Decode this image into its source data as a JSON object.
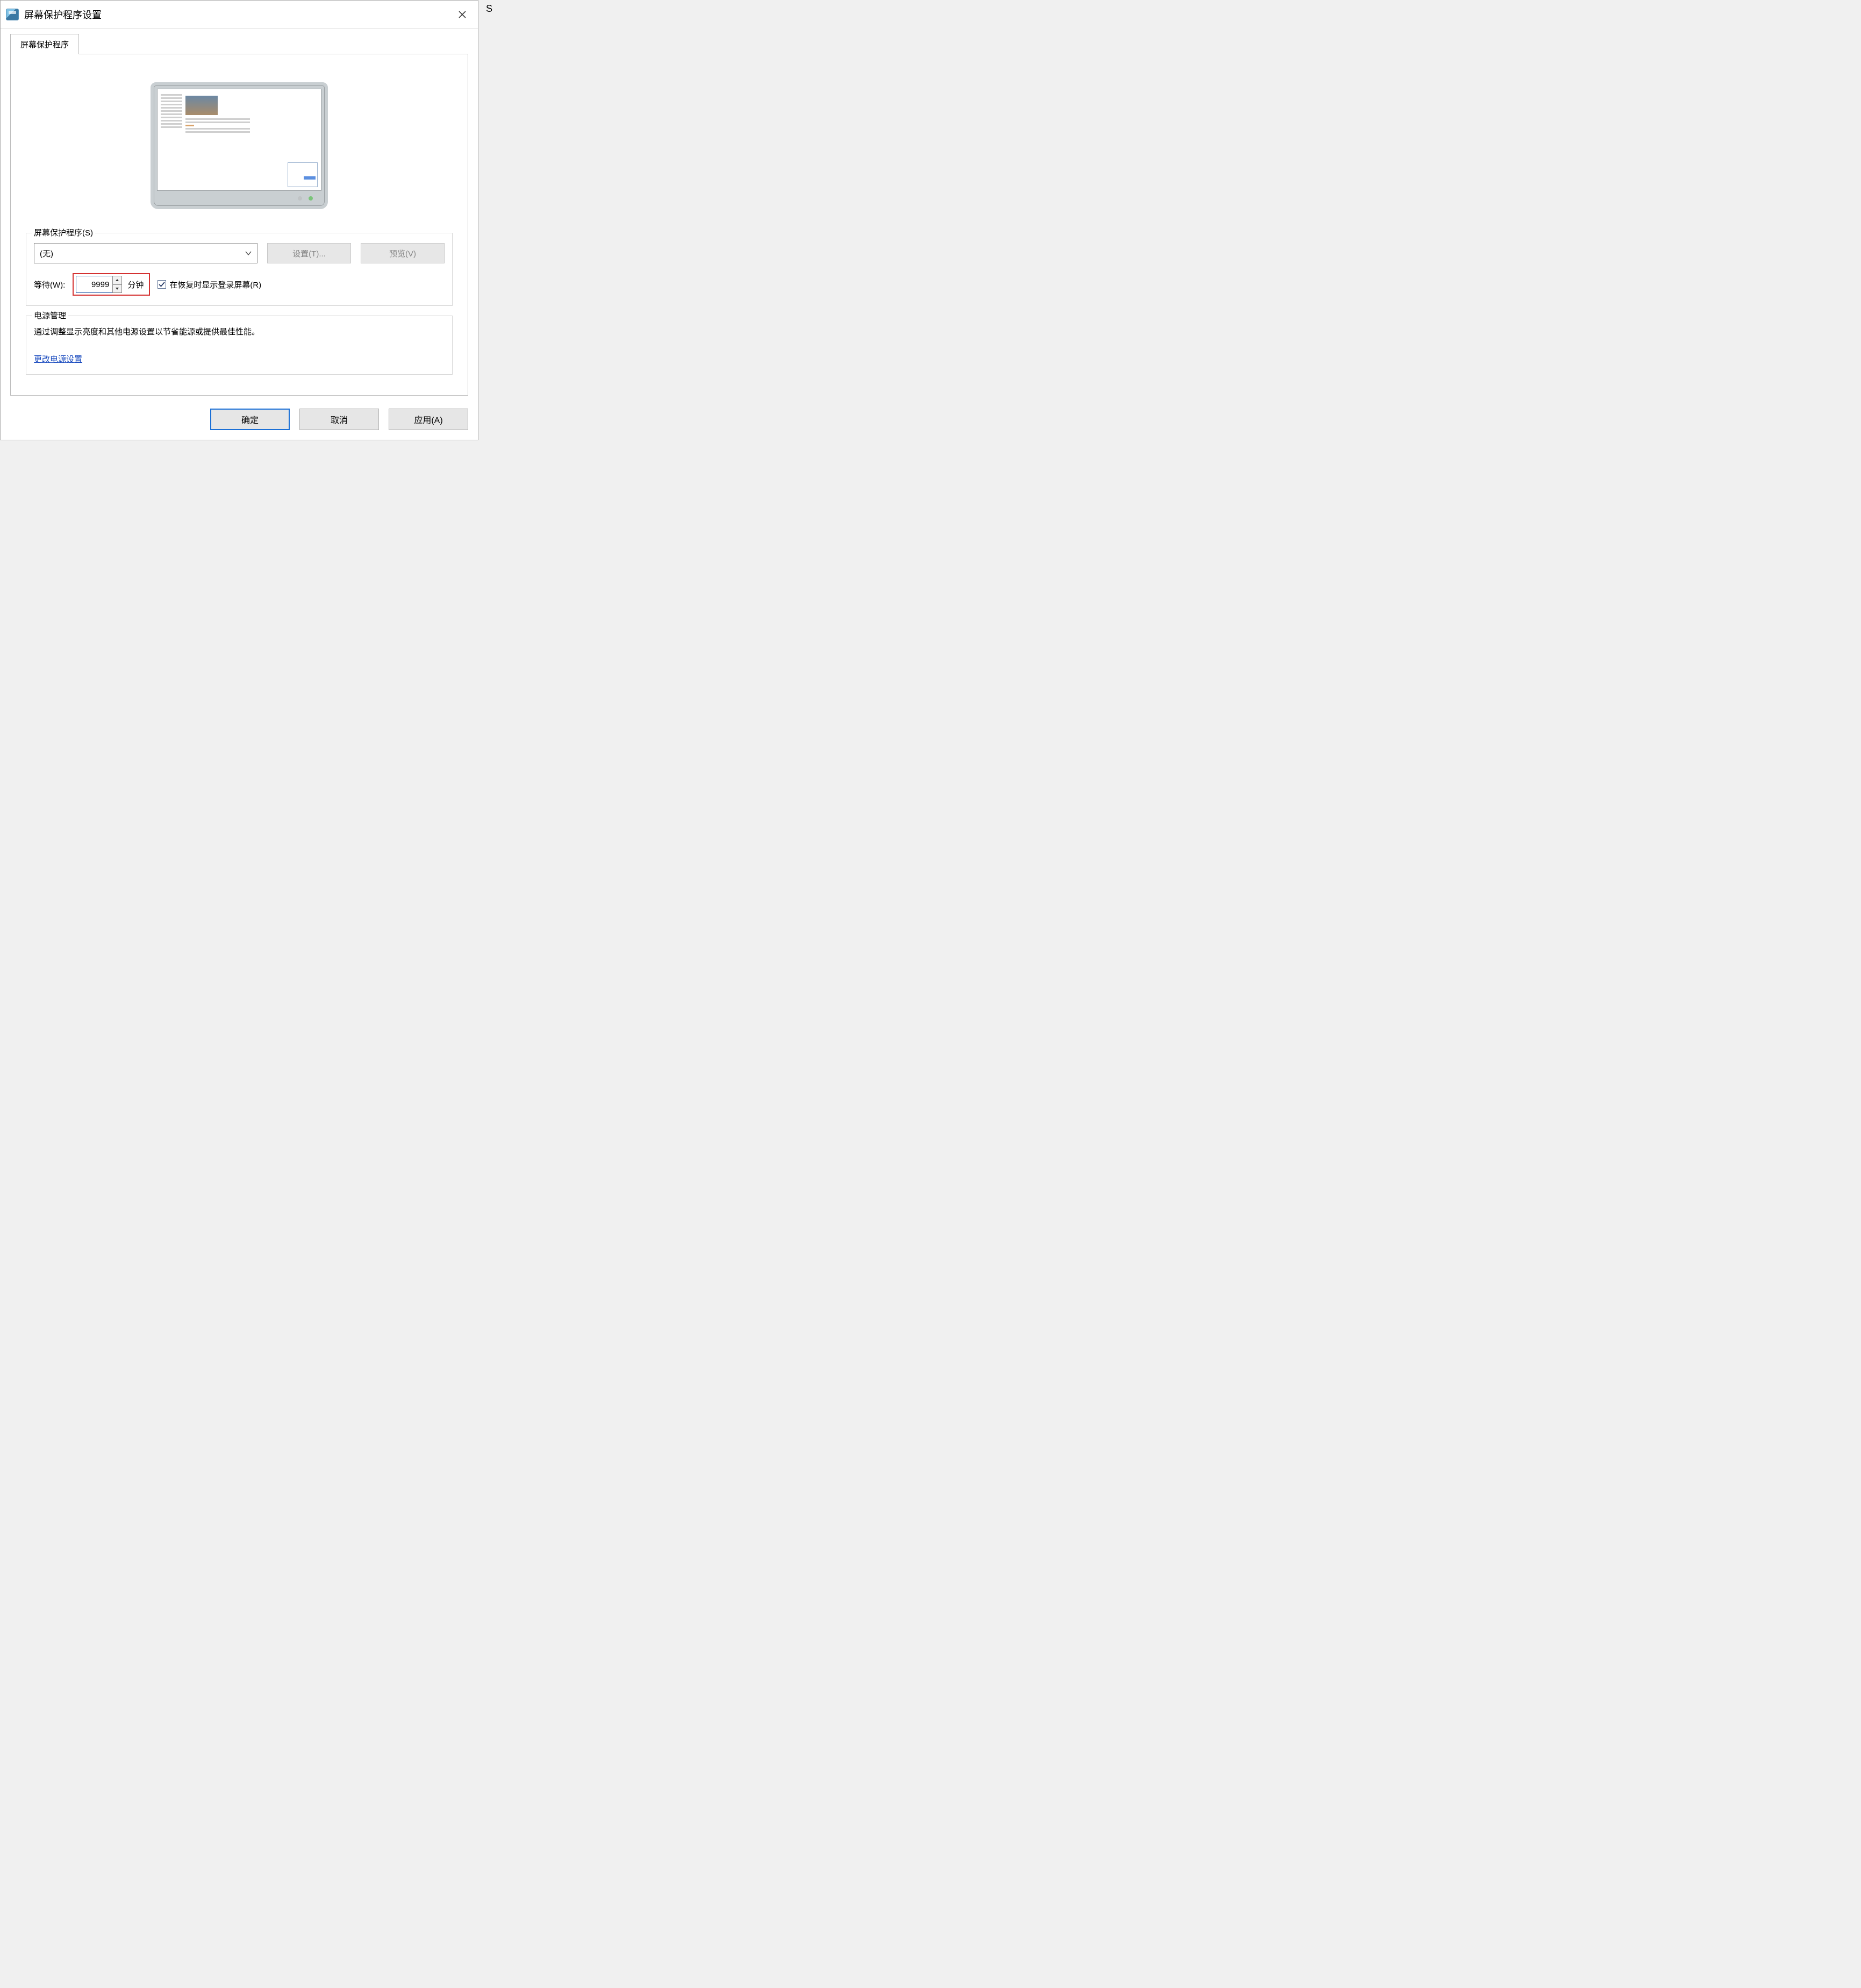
{
  "side_char": "S",
  "window": {
    "title": "屏幕保护程序设置"
  },
  "tab": "屏幕保护程序",
  "screensaver_group": {
    "legend": "屏幕保护程序(S)",
    "selected": "(无)",
    "settings_btn": "设置(T)...",
    "preview_btn": "预览(V)",
    "wait_label": "等待(W):",
    "wait_value": "9999",
    "minutes_label": "分钟",
    "resume_check_label": "在恢复时显示登录屏幕(R)",
    "resume_checked": true
  },
  "power_group": {
    "legend": "电源管理",
    "desc": "通过调整显示亮度和其他电源设置以节省能源或提供最佳性能。",
    "link": "更改电源设置"
  },
  "buttons": {
    "ok": "确定",
    "cancel": "取消",
    "apply": "应用(A)"
  }
}
